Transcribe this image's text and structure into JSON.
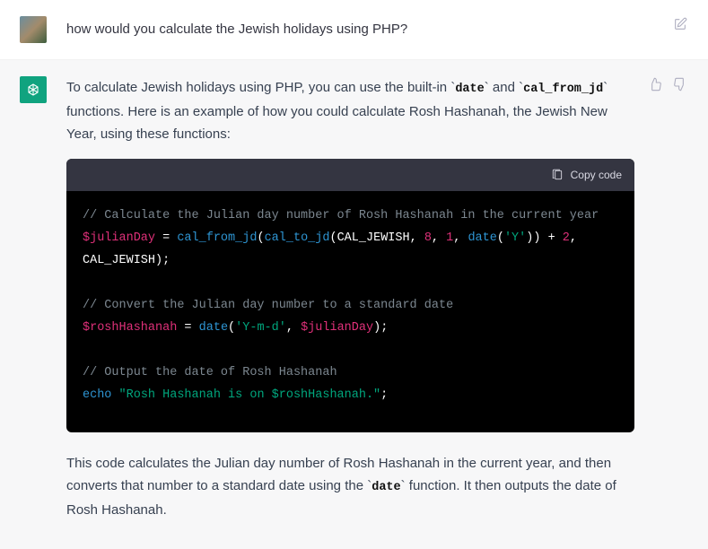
{
  "user_message": {
    "text": "how would you calculate the Jewish holidays using PHP?"
  },
  "assistant_message": {
    "intro_pre": "To calculate Jewish holidays using PHP, you can use the built-in ",
    "code1": "date",
    "intro_mid": " and ",
    "code2": "cal_from_jd",
    "intro_post": " functions. Here is an example of how you could calculate Rosh Hashanah, the Jewish New Year, using these functions:",
    "codeblock": {
      "copy_label": "Copy code",
      "lines": {
        "l1_comment": "// Calculate the Julian day number of Rosh Hashanah in the current year",
        "l2_var": "$julianDay",
        "l2_eq": " = ",
        "l2_fn1": "cal_from_jd",
        "l2_p1": "(",
        "l2_fn2": "cal_to_jd",
        "l2_p2": "(CAL_JEWISH, ",
        "l2_n1": "8",
        "l2_c1": ", ",
        "l2_n2": "1",
        "l2_c2": ", ",
        "l2_fn3": "date",
        "l2_p3": "(",
        "l2_s1": "'Y'",
        "l2_p4": ")) + ",
        "l2_n3": "2",
        "l2_c3": ",",
        "l3_txt": "CAL_JEWISH);",
        "l5_comment": "// Convert the Julian day number to a standard date",
        "l6_var": "$roshHashanah",
        "l6_eq": " = ",
        "l6_fn": "date",
        "l6_p1": "(",
        "l6_s1": "'Y-m-d'",
        "l6_c1": ", ",
        "l6_v2": "$julianDay",
        "l6_p2": ");",
        "l8_comment": "// Output the date of Rosh Hashanah",
        "l9_kw": "echo",
        "l9_sp": " ",
        "l9_s1": "\"Rosh Hashanah is on $roshHashanah.\"",
        "l9_p1": ";"
      }
    },
    "outro_pre": "This code calculates the Julian day number of Rosh Hashanah in the current year, and then converts that number to a standard date using the ",
    "outro_code": "date",
    "outro_post": " function. It then outputs the date of Rosh Hashanah."
  }
}
